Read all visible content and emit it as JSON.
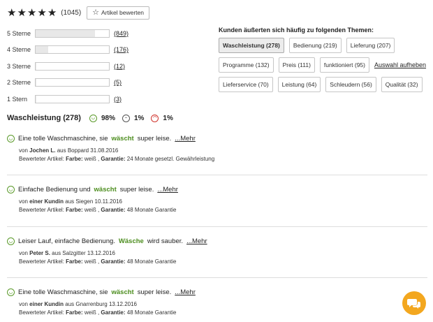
{
  "summary": {
    "stars_filled": 5,
    "total_count": "(1045)",
    "rate_button": "Artikel bewerten"
  },
  "distribution": [
    {
      "label": "5 Sterne",
      "count": "(849)",
      "fraction": 0.81
    },
    {
      "label": "4 Sterne",
      "count": "(176)",
      "fraction": 0.17
    },
    {
      "label": "3 Sterne",
      "count": "(12)",
      "fraction": 0.01
    },
    {
      "label": "2 Sterne",
      "count": "(5)",
      "fraction": 0.005
    },
    {
      "label": "1 Stern",
      "count": "(3)",
      "fraction": 0.003
    }
  ],
  "topics": {
    "title": "Kunden äußerten sich häufig zu folgenden Themen:",
    "row1": [
      "Waschleistung (278)",
      "Bedienung (219)",
      "Lieferung (207)"
    ],
    "row2": [
      "Programme (132)",
      "Preis (111)",
      "funktioniert (95)"
    ],
    "row3": [
      "Lieferservice (70)",
      "Leistung (64)",
      "Schleudern (56)",
      "Qualität (32)"
    ],
    "reset_link": "Auswahl aufheben"
  },
  "filter": {
    "title": "Waschleistung (278)",
    "positive": "98%",
    "neutral": "1%",
    "negative": "1%"
  },
  "reviews": [
    {
      "pre": "Eine tolle Waschmaschine, sie",
      "hl": "wäscht",
      "post": "super leise.",
      "more": "...Mehr",
      "von": "von",
      "author": "Jochen L.",
      "origin": "aus Boppard 31.08.2016",
      "article_label": "Bewerteter Artikel:",
      "farbe_label": "Farbe:",
      "farbe": "weiß ,",
      "garantie_label": "Garantie:",
      "garantie": "24 Monate gesetzl. Gewährleistung"
    },
    {
      "pre": "Einfache Bedienung und",
      "hl": "wäscht",
      "post": "super leise.",
      "more": "...Mehr",
      "von": "von",
      "author": "einer Kundin",
      "origin": "aus Siegen 10.11.2016",
      "article_label": "Bewerteter Artikel:",
      "farbe_label": "Farbe:",
      "farbe": "weiß ,",
      "garantie_label": "Garantie:",
      "garantie": "48 Monate Garantie"
    },
    {
      "pre": "Leiser Lauf, einfache Bedienung.",
      "hl": "Wäsche",
      "post": "wird sauber.",
      "more": "...Mehr",
      "von": "von",
      "author": "Peter S.",
      "origin": "aus Salzgitter 13.12.2016",
      "article_label": "Bewerteter Artikel:",
      "farbe_label": "Farbe:",
      "farbe": "weiß ,",
      "garantie_label": "Garantie:",
      "garantie": "48 Monate Garantie"
    },
    {
      "pre": "Eine tolle Waschmaschine, sie",
      "hl": "wäscht",
      "post": "super leise.",
      "more": "...Mehr",
      "von": "von",
      "author": "einer Kundin",
      "origin": "aus Gnarrenburg 13.12.2016",
      "article_label": "Bewerteter Artikel:",
      "farbe_label": "Farbe:",
      "farbe": "weiß ,",
      "garantie_label": "Garantie:",
      "garantie": "48 Monate Garantie"
    }
  ],
  "colors": {
    "highlight": "#4c8d1e",
    "chat_button": "#f3a71f",
    "negative": "#d0342c"
  },
  "icons": {
    "star": "star-icon",
    "rate": "speech-bubble-star-icon",
    "positive": "smiley-happy-icon",
    "neutral": "smiley-neutral-icon",
    "negative": "smiley-sad-icon",
    "chat": "chat-bubbles-icon"
  }
}
